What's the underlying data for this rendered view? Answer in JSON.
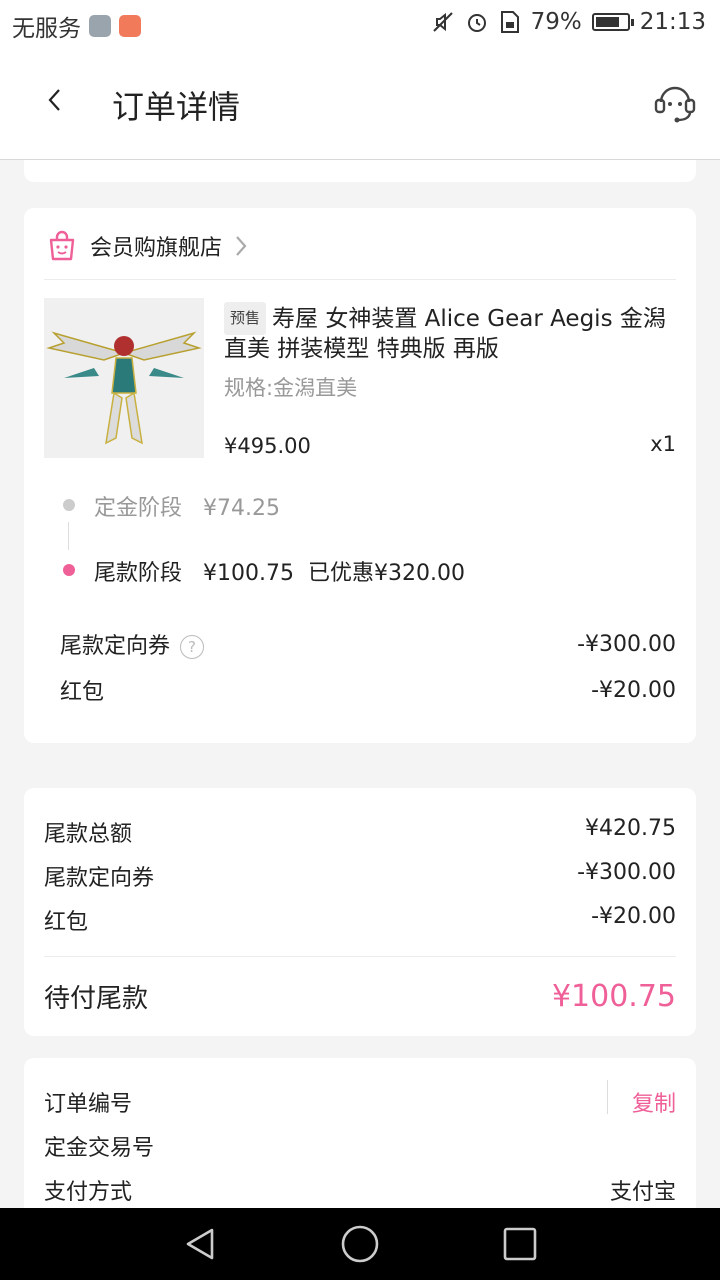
{
  "status_bar": {
    "carrier": "无服务",
    "battery": "79%",
    "battery_level": 0.79,
    "time": "21:13"
  },
  "header": {
    "title": "订单详情",
    "back_icon": "chevron-left-icon",
    "service_icon": "customer-service-icon"
  },
  "shop": {
    "name": "会员购旗舰店",
    "product": {
      "tag": "预售",
      "name": "寿屋 女神装置 Alice Gear Aegis 金潟直美 拼装模型 特典版 再版",
      "spec": "规格:金潟直美",
      "price": "¥495.00",
      "qty": "x1"
    },
    "stages": [
      {
        "label": "定金阶段",
        "amount": "¥74.25",
        "note": ""
      },
      {
        "label": "尾款阶段",
        "amount": "¥100.75",
        "note": "已优惠¥320.00"
      }
    ],
    "discounts": [
      {
        "label": "尾款定向券",
        "value": "-¥300.00"
      },
      {
        "label": "红包",
        "value": "-¥20.00"
      }
    ]
  },
  "totals": {
    "rows": [
      {
        "label": "尾款总额",
        "value": "¥420.75"
      },
      {
        "label": "尾款定向券",
        "value": "-¥300.00"
      },
      {
        "label": "红包",
        "value": "-¥20.00"
      }
    ],
    "pay_label": "待付尾款",
    "pay_amount": "¥100.75"
  },
  "order_info": {
    "order_no_label": "订单编号",
    "copy_label": "复制",
    "deposit_txn_label": "定金交易号",
    "pay_method_label": "支付方式",
    "pay_method_value": "支付宝"
  },
  "colors": {
    "accent": "#ef5f98",
    "muted": "#999999",
    "dot_inactive": "#cccccc"
  }
}
